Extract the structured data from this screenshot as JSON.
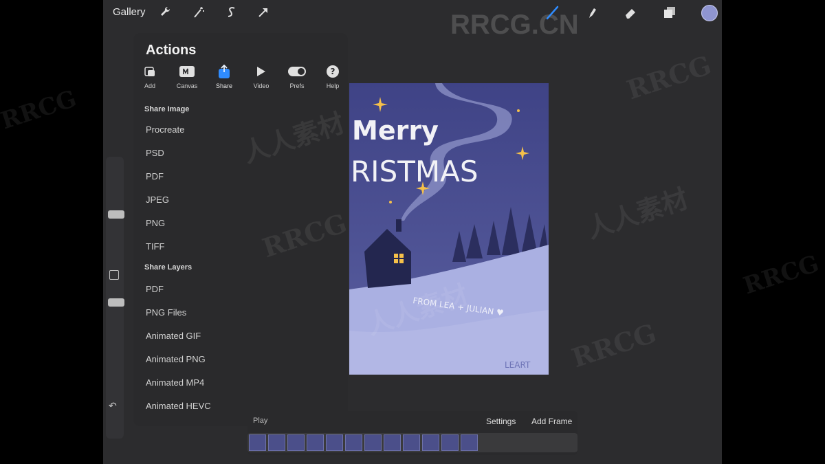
{
  "topbar": {
    "gallery": "Gallery",
    "left_icons": [
      "wrench-icon",
      "magic-wand-icon",
      "selection-icon",
      "transform-arrow-icon"
    ],
    "right_icons": [
      "brush-icon",
      "smudge-icon",
      "eraser-icon",
      "layers-icon"
    ],
    "color": "#8f95d0"
  },
  "actions": {
    "title": "Actions",
    "tabs": [
      {
        "label": "Add",
        "icon": "add-icon"
      },
      {
        "label": "Canvas",
        "icon": "canvas-icon"
      },
      {
        "label": "Share",
        "icon": "share-icon",
        "active": true
      },
      {
        "label": "Video",
        "icon": "play-icon"
      },
      {
        "label": "Prefs",
        "icon": "toggle-icon"
      },
      {
        "label": "Help",
        "icon": "help-icon"
      }
    ],
    "share_image_header": "Share Image",
    "share_image": [
      "Procreate",
      "PSD",
      "PDF",
      "JPEG",
      "PNG",
      "TIFF"
    ],
    "share_layers_header": "Share Layers",
    "share_layers": [
      "PDF",
      "PNG Files",
      "Animated GIF",
      "Animated PNG",
      "Animated MP4",
      "Animated HEVC"
    ]
  },
  "artwork": {
    "line1": "Merry",
    "line2": "RISTMAS",
    "handwriting": "FROM LEA + JULIAN ♥",
    "signature": "LEART"
  },
  "timeline": {
    "play": "Play",
    "settings": "Settings",
    "add_frame": "Add Frame",
    "frame_count": 12
  },
  "watermark": {
    "top": "RRCG.CN",
    "repeat_a": "RRCG",
    "repeat_b": "人人素材"
  },
  "colors": {
    "accent": "#2f8cff",
    "canvas_sky": "#4c5192",
    "snow": "#aab0e2",
    "window_light": "#f5c04a"
  }
}
